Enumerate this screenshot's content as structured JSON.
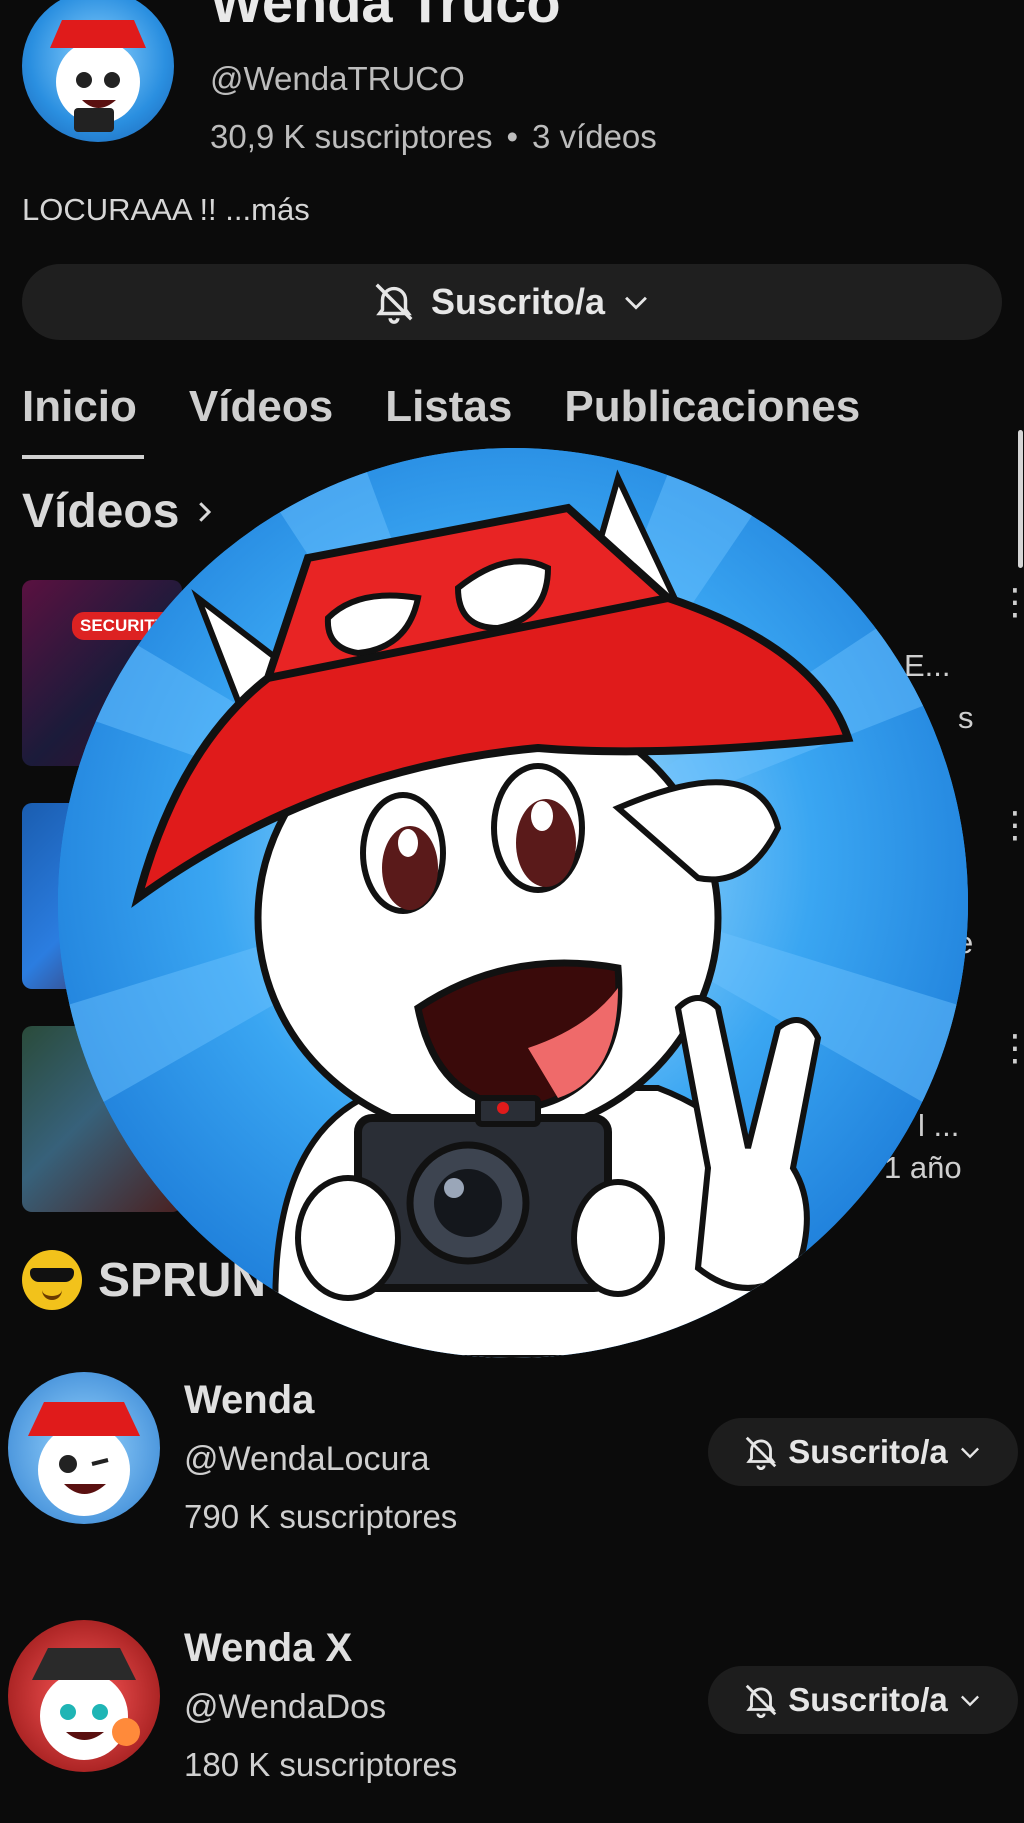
{
  "header": {
    "channel_name": "Wenda Truco",
    "handle": "@WendaTRUCO",
    "subscribers": "30,9 K suscriptores",
    "separator": "•",
    "videos_count": "3 vídeos",
    "description": "LOCURAAA !! ...más",
    "subscribe_label": "Suscrito/a"
  },
  "tabs": [
    "Inicio",
    "Vídeos",
    "Listas",
    "Publicaciones"
  ],
  "sections": {
    "videos_title": "Vídeos",
    "sprunki_title": "SPRUN"
  },
  "videos": [
    {
      "thumb_badge": "SECURITY",
      "title_fragment": "E...",
      "meta_fragment": "s"
    },
    {
      "meta_fragment": "e"
    },
    {
      "title_fragment": "l ...",
      "meta_fragment": "1 año"
    }
  ],
  "channels": [
    {
      "name": "Wenda",
      "handle": "@WendaLocura",
      "subscribers": "790 K suscriptores",
      "button": "Suscrito/a"
    },
    {
      "name": "Wenda X",
      "handle": "@WendaDos",
      "subscribers": "180 K suscriptores",
      "button": "Suscrito/a"
    }
  ],
  "colors": {
    "background": "#0b0b0b",
    "pill": "#1f1f1f",
    "hat_red": "#e01b1b",
    "avatar_blue": "#1f8fe6"
  },
  "icons": {
    "bell": "bell-off-icon",
    "chevron": "chevron-down-icon",
    "arrow": "chevron-right-icon",
    "more": "more-vert-icon"
  }
}
